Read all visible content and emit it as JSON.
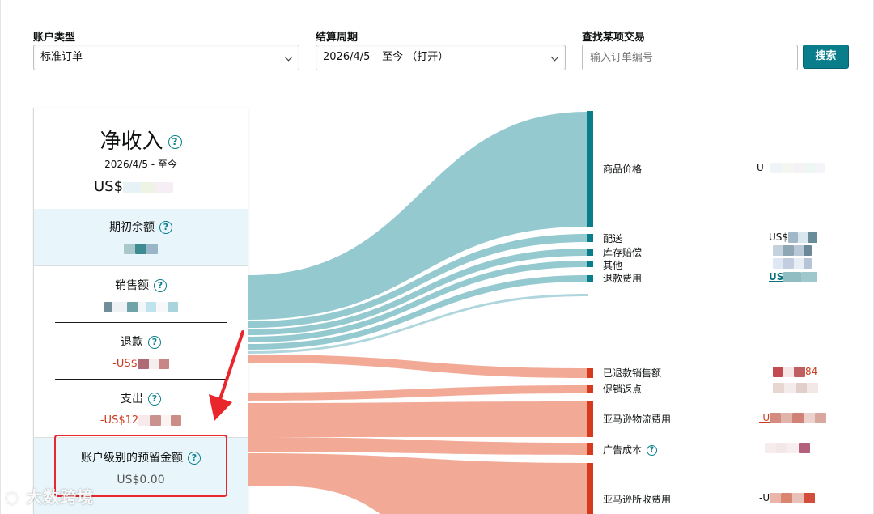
{
  "filters": {
    "account_type": {
      "label": "账户类型",
      "value": "标准订单"
    },
    "settlement_period": {
      "label": "结算周期",
      "value": "2026/4/5 – 至今 （打开）"
    },
    "find_transaction": {
      "label": "查找某项交易",
      "placeholder": "输入订单编号"
    },
    "search_label": "搜索"
  },
  "summary": {
    "title": "净收入",
    "date_range": "2026/4/5 - 至今",
    "net_amount_prefix": "US$",
    "opening_balance": {
      "label": "期初余额"
    },
    "sales": {
      "label": "销售额"
    },
    "refunds": {
      "label": "退款",
      "value_prefix": "-US$"
    },
    "payouts": {
      "label": "支出",
      "value_prefix": "-US$12"
    },
    "reserve": {
      "label": "账户级别的预留金额",
      "value": "US$0.00"
    }
  },
  "breakdown": {
    "income": [
      {
        "label": "商品价格",
        "value_prefix": "U"
      },
      {
        "label": "配送",
        "value_prefix": "US$"
      },
      {
        "label": "库存赔偿"
      },
      {
        "label": "其他"
      },
      {
        "label": "退款费用",
        "value_prefix": "US"
      }
    ],
    "expenses": [
      {
        "label": "已退款销售额",
        "value_suffix": "84"
      },
      {
        "label": "促销返点"
      },
      {
        "label": "亚马逊物流费用",
        "value_prefix": "-U"
      },
      {
        "label": "广告成本"
      },
      {
        "label": "亚马逊所收费用",
        "value_prefix": "-U"
      }
    ]
  },
  "colors": {
    "teal": "#0a7d8b",
    "income_flow": "#94c9d0",
    "expense_flow": "#f2a996",
    "expense_bar": "#d63a1e",
    "negative_text": "#cc3b1f",
    "callout": "#e8262b"
  },
  "watermark": "大数跨境"
}
